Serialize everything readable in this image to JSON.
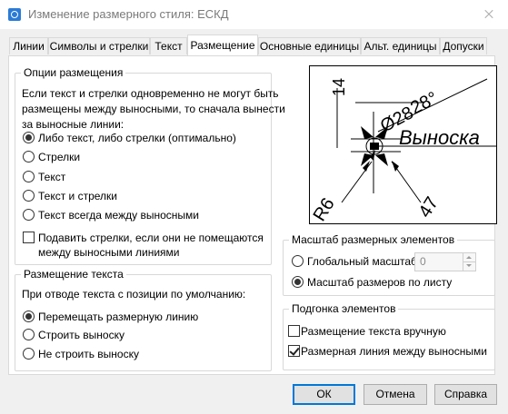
{
  "window": {
    "title": "Изменение размерного стиля: ЕСКД"
  },
  "tabs": [
    {
      "label": "Линии"
    },
    {
      "label": "Символы и стрелки"
    },
    {
      "label": "Текст"
    },
    {
      "label": "Размещение"
    },
    {
      "label": "Основные единицы"
    },
    {
      "label": "Альт. единицы"
    },
    {
      "label": "Допуски"
    }
  ],
  "fit_options": {
    "title": "Опции размещения",
    "description": [
      "Если текст и стрелки одновременно не могут быть",
      "размещены между выносными, то сначала вынести",
      "за выносные линии:"
    ],
    "options": [
      {
        "label": "Либо текст, либо стрелки (оптимально)",
        "selected": true
      },
      {
        "label": "Стрелки",
        "selected": false
      },
      {
        "label": "Текст",
        "selected": false
      },
      {
        "label": "Текст и стрелки",
        "selected": false
      },
      {
        "label": "Текст всегда между выносными",
        "selected": false
      }
    ],
    "suppress": {
      "line1": "Подавить стрелки, если они не помещаются",
      "line2": "между выносными линиями",
      "checked": false
    }
  },
  "text_placement": {
    "title": "Размещение текста",
    "description": "При отводе текста с позиции по умолчанию:",
    "options": [
      {
        "label": "Перемещать размерную линию",
        "selected": true
      },
      {
        "label": "Строить выноску",
        "selected": false
      },
      {
        "label": "Не строить выноску",
        "selected": false
      }
    ]
  },
  "preview": {
    "labels": {
      "dim14": "14",
      "angle": "28°",
      "leader_text": "Выноска",
      "radius": "R6",
      "dim47": "47",
      "diameter": "Ø28"
    }
  },
  "scale": {
    "title": "Масштаб размерных элементов",
    "global_label": "Глобальный масштаб:",
    "global_value": "0",
    "layout_label": "Масштаб размеров по листу",
    "selected": "layout"
  },
  "fine_tuning": {
    "title": "Подгонка элементов",
    "manual": {
      "label": "Размещение текста вручную",
      "checked": false
    },
    "draw_line": {
      "label": "Размерная линия между выносными",
      "checked": true
    }
  },
  "buttons": {
    "ok": "ОК",
    "cancel": "Отмена",
    "help": "Справка"
  }
}
